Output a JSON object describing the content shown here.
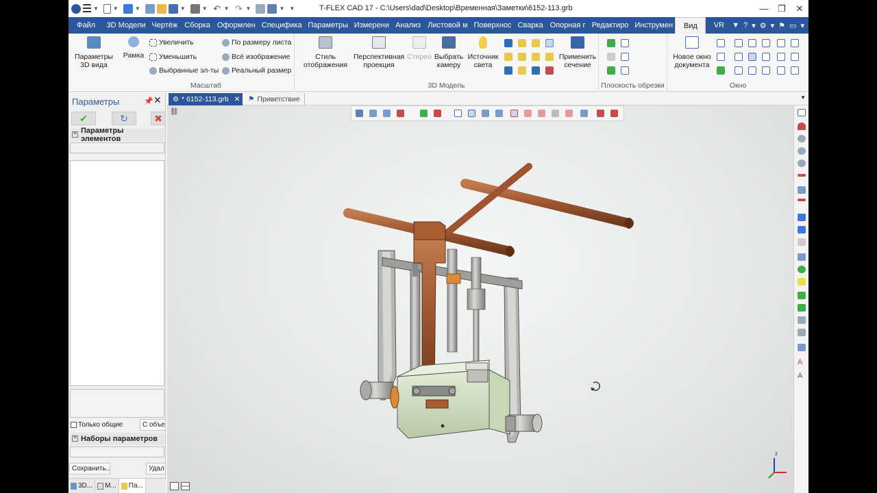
{
  "window": {
    "title": "T-FLEX CAD 17 - C:\\Users\\dad\\Desktop\\Временная\\Заметки\\6152-113.grb",
    "minimize": "—",
    "maximize": "❐",
    "close": "✕"
  },
  "ribbon_tabs": [
    {
      "label": "Файл"
    },
    {
      "label": "3D Модели"
    },
    {
      "label": "Чертёж"
    },
    {
      "label": "Сборка"
    },
    {
      "label": "Оформлен"
    },
    {
      "label": "Специфика"
    },
    {
      "label": "Параметры"
    },
    {
      "label": "Измерени"
    },
    {
      "label": "Анализ"
    },
    {
      "label": "Листовой м"
    },
    {
      "label": "Поверхнос"
    },
    {
      "label": "Сварка"
    },
    {
      "label": "Опорная г"
    },
    {
      "label": "Редактиро"
    },
    {
      "label": "Инструмен"
    },
    {
      "label": "Вид"
    },
    {
      "label": "VR"
    }
  ],
  "ribbon": {
    "params3d": "Параметры 3D вида",
    "frame": "Рамка",
    "zoom_in": "Увеличить",
    "zoom_out": "Уменьшить",
    "selected": "Выбранные эл-ты",
    "fit_sheet": "По размеру листа",
    "whole_image": "Всё изображение",
    "real_size": "Реальный размер",
    "scale_group": "Масштаб",
    "display_style": "Стиль отображения",
    "perspective": "Перспективная проекция",
    "stereo": "Стерео",
    "choose_camera": "Выбрать камеру",
    "light_source": "Источник света",
    "apply_section": "Применить сечение",
    "model3d_group": "3D Модель",
    "clip_plane_group": "Плоскость обрезки",
    "new_window": "Новое окно документа",
    "window_group": "Окно"
  },
  "left_panel": {
    "title": "Параметры",
    "pin": "📌",
    "close": "✕",
    "ok": "✔",
    "refresh": "↻",
    "cancel": "✖",
    "section_elements": "Параметры элементов",
    "only_common": "Только общие",
    "with_object": "С объе",
    "section_sets": "Наборы параметров",
    "save": "Сохранить...",
    "delete": "Удал",
    "bottom_tabs": [
      {
        "label": "3D..."
      },
      {
        "label": "М..."
      },
      {
        "label": "Па..."
      }
    ]
  },
  "doc_tabs": {
    "active": "* 6152-113.grb",
    "active_close": "✕",
    "welcome": "Приветствие"
  },
  "viewport": {
    "triad_z": "z"
  },
  "colors": {
    "ribbon_blue": "#2b579a",
    "copper": "#a0522d",
    "body_green": "#d6e4c8"
  }
}
